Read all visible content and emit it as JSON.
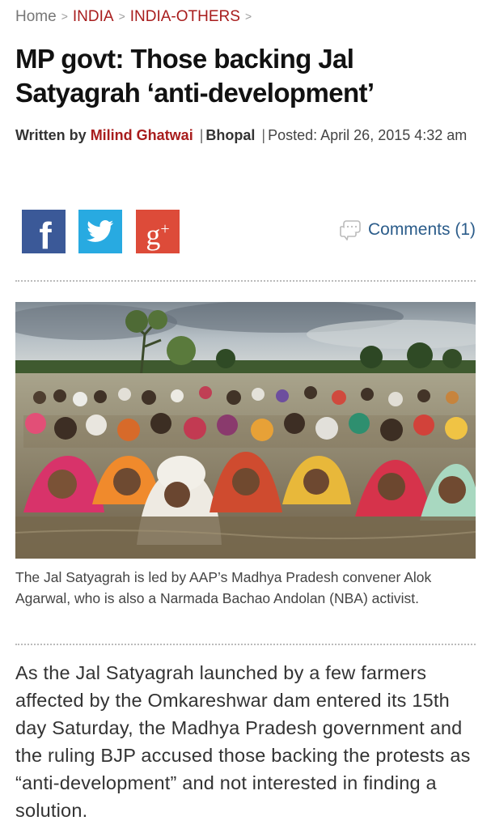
{
  "breadcrumb": {
    "home": "Home",
    "separator": ">",
    "items": [
      "INDIA",
      "INDIA-OTHERS"
    ]
  },
  "article": {
    "headline": "MP govt: Those backing Jal Satyagrah ‘anti-development’",
    "byline": {
      "written_by": "Written by",
      "author": "Milind Ghatwai",
      "separator": "|",
      "location": "Bhopal",
      "posted": "Posted: April 26, 2015 4:32 am"
    },
    "caption": "The Jal Satyagrah is led by AAP’s Madhya Pradesh convener Alok Agarwal, who is also a Narmada Bachao Andolan (NBA) activist.",
    "lead": "As the Jal Satyagrah launched by a few farmers affected by the Omkareshwar dam entered its 15th day Saturday, the Madhya Pradesh government and the ruling BJP accused those backing the protests as “anti-development” and not interested in finding a solution."
  },
  "share": {
    "facebook_icon": "facebook-icon",
    "twitter_icon": "twitter-icon",
    "googleplus_icon": "google-plus-icon",
    "comments_icon": "speech-bubble-icon",
    "comments_label": "Comments (1)"
  },
  "colors": {
    "accent_red": "#a81d1d",
    "facebook": "#3b5998",
    "twitter": "#28aae1",
    "googleplus": "#dd4b39",
    "link_blue": "#2b5c8a"
  }
}
